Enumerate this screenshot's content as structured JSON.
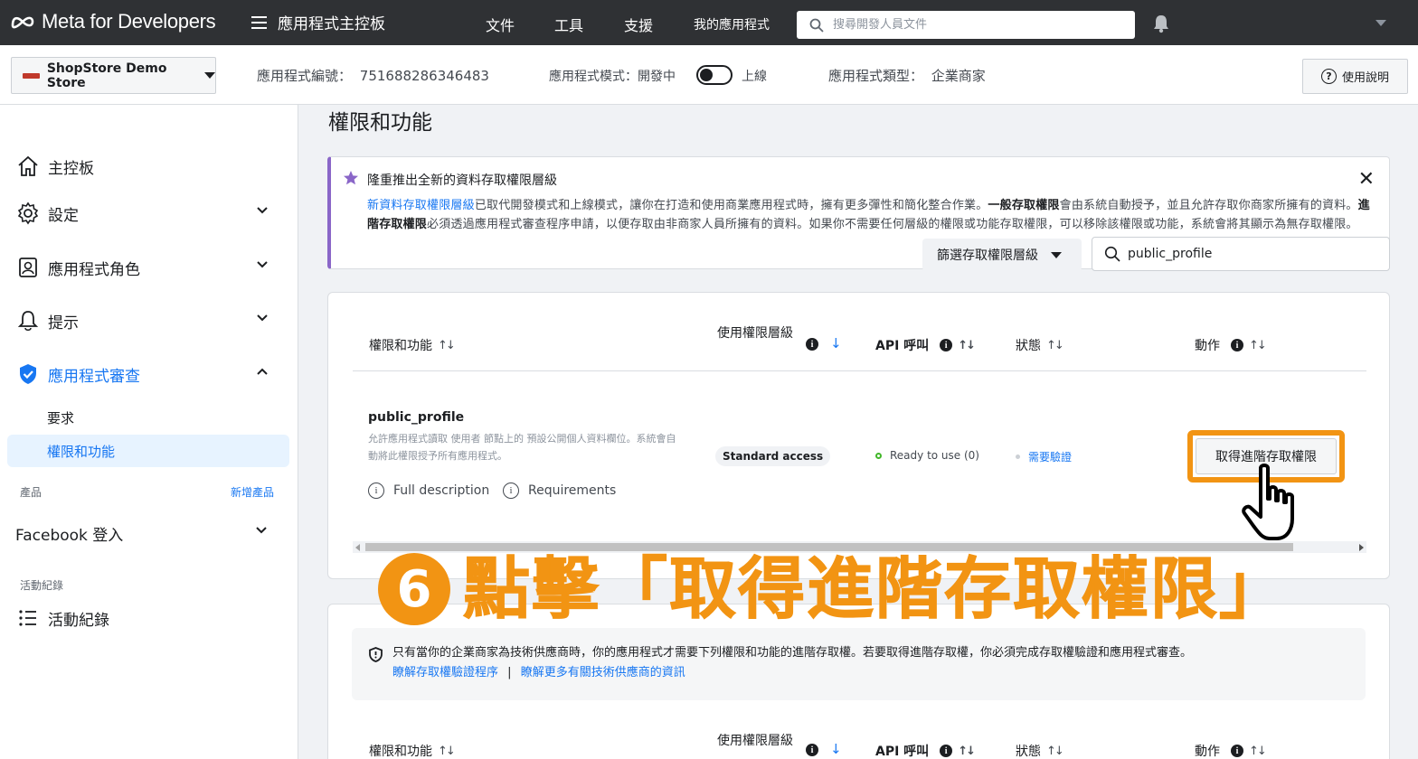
{
  "header": {
    "logo_text": "Meta for Developers",
    "menu_title": "應用程式主控板",
    "nav": [
      "文件",
      "工具",
      "支援",
      "我的應用程式"
    ],
    "search_placeholder": "搜尋開發人員文件"
  },
  "appbar": {
    "app_name": "ShopStore Demo Store",
    "app_id_label": "應用程式編號：",
    "app_id": "751688286346483",
    "mode_label": "應用程式模式：開發中",
    "mode_live": "上線",
    "type_label": "應用程式類型：",
    "type_value": "企業商家",
    "help_label": "使用說明"
  },
  "sidebar": {
    "items": [
      {
        "label": "主控板",
        "icon": "home-icon"
      },
      {
        "label": "設定",
        "icon": "gear-icon"
      },
      {
        "label": "應用程式角色",
        "icon": "person-badge-icon"
      },
      {
        "label": "提示",
        "icon": "bell-icon"
      },
      {
        "label": "應用程式審查",
        "icon": "shield-check-icon"
      },
      {
        "label": "Facebook 登入",
        "icon": ""
      },
      {
        "label": "活動紀錄",
        "icon": "list-icon"
      }
    ],
    "sub_items": [
      "要求",
      "權限和功能"
    ],
    "section_products": "產品",
    "add_product": "新增產品",
    "section_activity": "活動紀錄"
  },
  "main": {
    "page_title": "權限和功能",
    "notice": {
      "title": "隆重推出全新的資料存取權限層級",
      "link": "新資料存取權限層級",
      "body_1": "已取代開發模式和上線模式，讓你在打造和使用商業應用程式時，擁有更多彈性和簡化整合作業。",
      "bold_1": "一般存取權限",
      "body_2": "會由系統自動授予，並且允許存取你商家所擁有的資料。",
      "bold_2": "進階存取權限",
      "body_3": "必須透過應用程式審查程序申請，以便存取由非商家人員所擁有的資料。如果你不需要任何層級的權限或功能存取權限，可以移除該權限或功能，系統會將其顯示為無存取權限。"
    },
    "filter_label": "篩選存取權限層級",
    "filter_search_value": "public_profile",
    "table": {
      "headers": [
        "權限和功能",
        "使用權限層級",
        "API 呼叫",
        "狀態",
        "動作"
      ],
      "sort_symbol": "↑↓",
      "sort_active": "↓",
      "row": {
        "name": "public_profile",
        "desc": "允許應用程式讀取 使用者 節點上的 預設公開個人資料欄位。系統會自動將此權限授予所有應用程式。",
        "full_description": "Full description",
        "requirements": "Requirements",
        "access_level": "Standard access",
        "api_calls": "Ready to use (0)",
        "status": "需要驗證",
        "action": "取得進階存取權限"
      }
    },
    "annotation": {
      "number": "6",
      "text": "點擊「取得進階存取權限」"
    },
    "note": {
      "text": "只有當你的企業商家為技術供應商時，你的應用程式才需要下列權限和功能的進階存取權。若要取得進階存取權，你必須完成存取權驗證和應用程式審查。",
      "link1": "瞭解存取權驗證程序",
      "separator": "|",
      "link2": "瞭解更多有關技術供應商的資訊"
    }
  },
  "colors": {
    "accent": "#1877f2",
    "highlight": "#f29413",
    "topbar": "#2f3134"
  }
}
